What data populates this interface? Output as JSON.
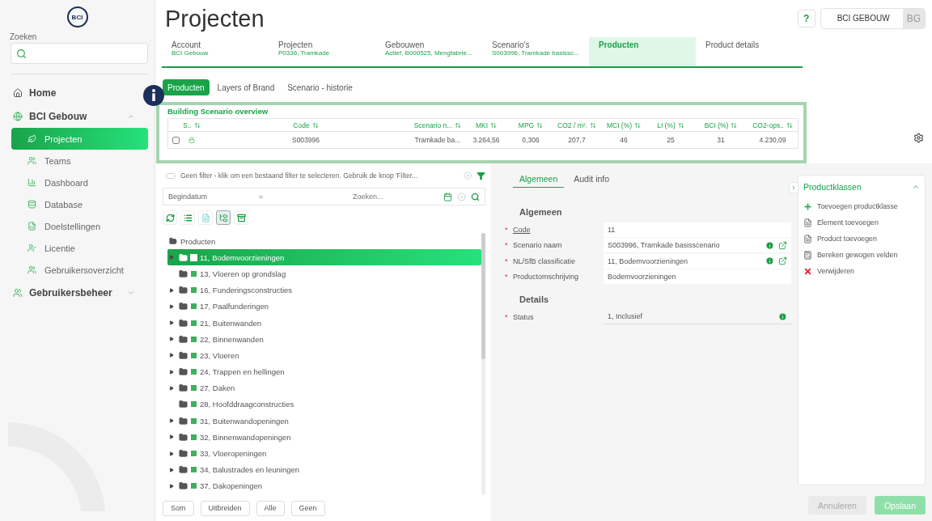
{
  "logo": {
    "text": "BCI"
  },
  "sidebar": {
    "search_label": "Zoeken",
    "items": [
      {
        "label": "Home"
      },
      {
        "label": "BCI Gebouw",
        "expanded": true,
        "children": [
          {
            "label": "Projecten",
            "selected": true
          },
          {
            "label": "Teams",
            "selected": false
          },
          {
            "label": "Dashboard",
            "selected": false
          },
          {
            "label": "Database",
            "selected": false
          },
          {
            "label": "Doelstellingen",
            "selected": false
          },
          {
            "label": "Licentie",
            "selected": false
          },
          {
            "label": "Gebruikersoverzicht",
            "selected": false
          }
        ]
      },
      {
        "label": "Gebruikersbeheer",
        "expanded": false
      }
    ]
  },
  "header": {
    "title": "Projecten",
    "help": "?",
    "user": {
      "name": "BCI GEBOUW",
      "initials": "BG"
    }
  },
  "breadcrumbs": [
    {
      "label": "Account",
      "value": "BCI Gebouw",
      "selected": false
    },
    {
      "label": "Projecten",
      "value": "P0336, Tramkade",
      "selected": false
    },
    {
      "label": "Gebouwen",
      "value": "Actief, B000525, Mengfabrie...",
      "selected": false
    },
    {
      "label": "Scenario's",
      "value": "S003996, Tramkade basissc...",
      "selected": false
    },
    {
      "label": "Producten",
      "selected": true
    },
    {
      "label": "Product details",
      "selected": false
    }
  ],
  "subtabs": [
    {
      "label": "Producten",
      "selected": true
    },
    {
      "label": "Layers of Brand",
      "selected": false
    },
    {
      "label": "Scenario - historie",
      "selected": false
    }
  ],
  "overview": {
    "title": "Building Scenario overview",
    "columns": [
      "S..",
      "Code",
      "Scenario n...",
      "MKI",
      "MPG",
      "CO2 / m².",
      "MCI (%)",
      "LI (%)",
      "BCI (%)",
      "CO2-ops.."
    ],
    "rows": [
      {
        "checked": false,
        "cells": [
          "",
          "S003996",
          "Tramkade ba...",
          "3.264,56",
          "0,306",
          "207,7",
          "46",
          "25",
          "31",
          "4.230,09"
        ]
      }
    ]
  },
  "filter": {
    "on": false,
    "text": "Geen filter - klik om een bestaand filter te selecteren. Gebruik de knop 'Filter..."
  },
  "query": {
    "field": "Begindatum",
    "operator": "=",
    "placeholder": "Zoeken..."
  },
  "tree": {
    "root": "Producten",
    "items": [
      {
        "label": "11, Bodemvoorzieningen",
        "expandable": true,
        "selected": true
      },
      {
        "label": "13, Vloeren op grondslag",
        "expandable": false,
        "selected": false
      },
      {
        "label": "16, Funderingsconstructies",
        "expandable": true,
        "selected": false
      },
      {
        "label": "17, Paalfunderingen",
        "expandable": true,
        "selected": false
      },
      {
        "label": "21, Buitenwanden",
        "expandable": true,
        "selected": false
      },
      {
        "label": "22, Binnenwanden",
        "expandable": true,
        "selected": false
      },
      {
        "label": "23, Vloeren",
        "expandable": true,
        "selected": false
      },
      {
        "label": "24, Trappen en hellingen",
        "expandable": true,
        "selected": false
      },
      {
        "label": "27, Daken",
        "expandable": true,
        "selected": false
      },
      {
        "label": "28, Hoofddraagconstructies",
        "expandable": false,
        "selected": false
      },
      {
        "label": "31, Buitenwandopeningen",
        "expandable": true,
        "selected": false
      },
      {
        "label": "32, Binnenwandopeningen",
        "expandable": true,
        "selected": false
      },
      {
        "label": "33, Vloeropeningen",
        "expandable": true,
        "selected": false
      },
      {
        "label": "34, Balustrades en leuningen",
        "expandable": true,
        "selected": false
      },
      {
        "label": "37, Dakopeningen",
        "expandable": true,
        "selected": false
      }
    ]
  },
  "tree_buttons": [
    "Som",
    "Uitbreiden",
    "Alle",
    "Geen"
  ],
  "form": {
    "tabs": [
      {
        "label": "Algemeen",
        "selected": true
      },
      {
        "label": "Audit info",
        "selected": false
      }
    ],
    "sections": [
      {
        "title": "Algemeen",
        "fields": [
          {
            "mark": "*",
            "label": "Code",
            "value": "11",
            "kind": "input",
            "underlined": true,
            "info": false,
            "link": false
          },
          {
            "mark": "*",
            "label": "Scenario naam",
            "value": "S003996, Tramkade basisscenario",
            "kind": "input",
            "underlined": false,
            "info": true,
            "link": true
          },
          {
            "mark": "*",
            "label": "NL/SfB classificatie",
            "value": "11, Bodemvoorzieningen",
            "kind": "input",
            "underlined": false,
            "info": true,
            "link": true
          },
          {
            "mark": "*",
            "label": "Productomschrijving",
            "value": "Bodemvoorzieningen",
            "kind": "input",
            "underlined": false,
            "info": false,
            "link": false
          }
        ]
      },
      {
        "title": "Details",
        "fields": [
          {
            "mark": "*",
            "label": "Status",
            "value": "1, Inclusief",
            "kind": "select",
            "underlined": false,
            "info": true,
            "link": false
          }
        ]
      }
    ]
  },
  "productklassen": {
    "title": "Productklassen",
    "actions": [
      {
        "label": "Toevoegen productklasse",
        "kind": "add"
      },
      {
        "label": "Element toevoegen",
        "kind": "element"
      },
      {
        "label": "Product toevoegen",
        "kind": "element"
      },
      {
        "label": "Bereken gewogen velden",
        "kind": "calc"
      },
      {
        "label": "Verwijderen",
        "kind": "delete"
      }
    ]
  },
  "footer": [
    {
      "label": "Annuleren",
      "kind": "secondary"
    },
    {
      "label": "Opslaan",
      "kind": "primary"
    }
  ]
}
